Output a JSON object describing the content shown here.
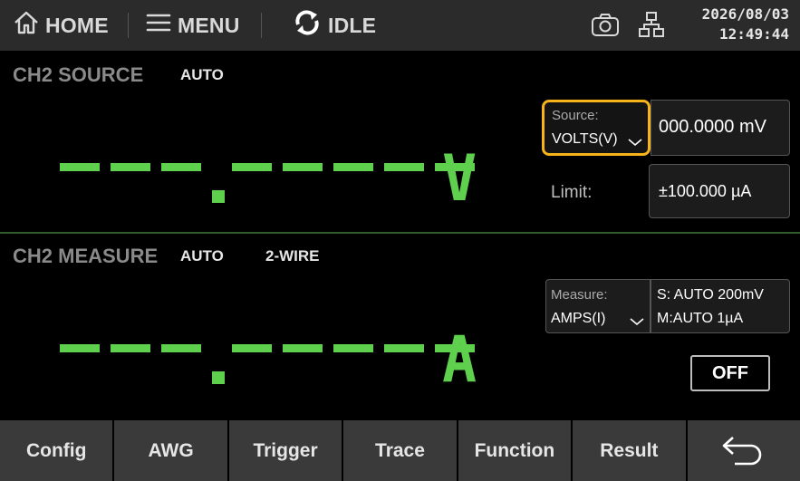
{
  "topbar": {
    "home_label": "HOME",
    "menu_label": "MENU",
    "status_label": "IDLE",
    "date": "2026/08/03",
    "time": "12:49:44",
    "icons": [
      "home-icon",
      "menu-icon",
      "refresh-icon",
      "camera-icon",
      "network-icon"
    ]
  },
  "source_panel": {
    "title": "CH2 SOURCE",
    "mode_tag": "AUTO",
    "readout_digits": "---.-----",
    "unit": "V",
    "source_label": "Source:",
    "source_selected": "VOLTS(V)",
    "source_value": "000.0000 mV",
    "limit_label": "Limit:",
    "limit_value": "±100.000 µA"
  },
  "measure_panel": {
    "title": "CH2 MEASURE",
    "mode_tag": "AUTO",
    "wire_tag": "2-WIRE",
    "readout_digits": "---.-----",
    "unit": "A",
    "measure_label": "Measure:",
    "measure_selected": "AMPS(I)",
    "range_source": "S:  AUTO 200mV",
    "range_measure": "M:AUTO 1µA",
    "output_button": "OFF"
  },
  "bottombar": {
    "keys": [
      "Config",
      "AWG",
      "Trigger",
      "Trace",
      "Function",
      "Result"
    ],
    "back_icon": "back-arrow-icon"
  },
  "colors": {
    "readout_green": "#5fcf4e",
    "highlight_orange": "#f6b31a",
    "topbar_bg": "#2b2b2b",
    "softkey_bg": "#3a3a3a"
  }
}
